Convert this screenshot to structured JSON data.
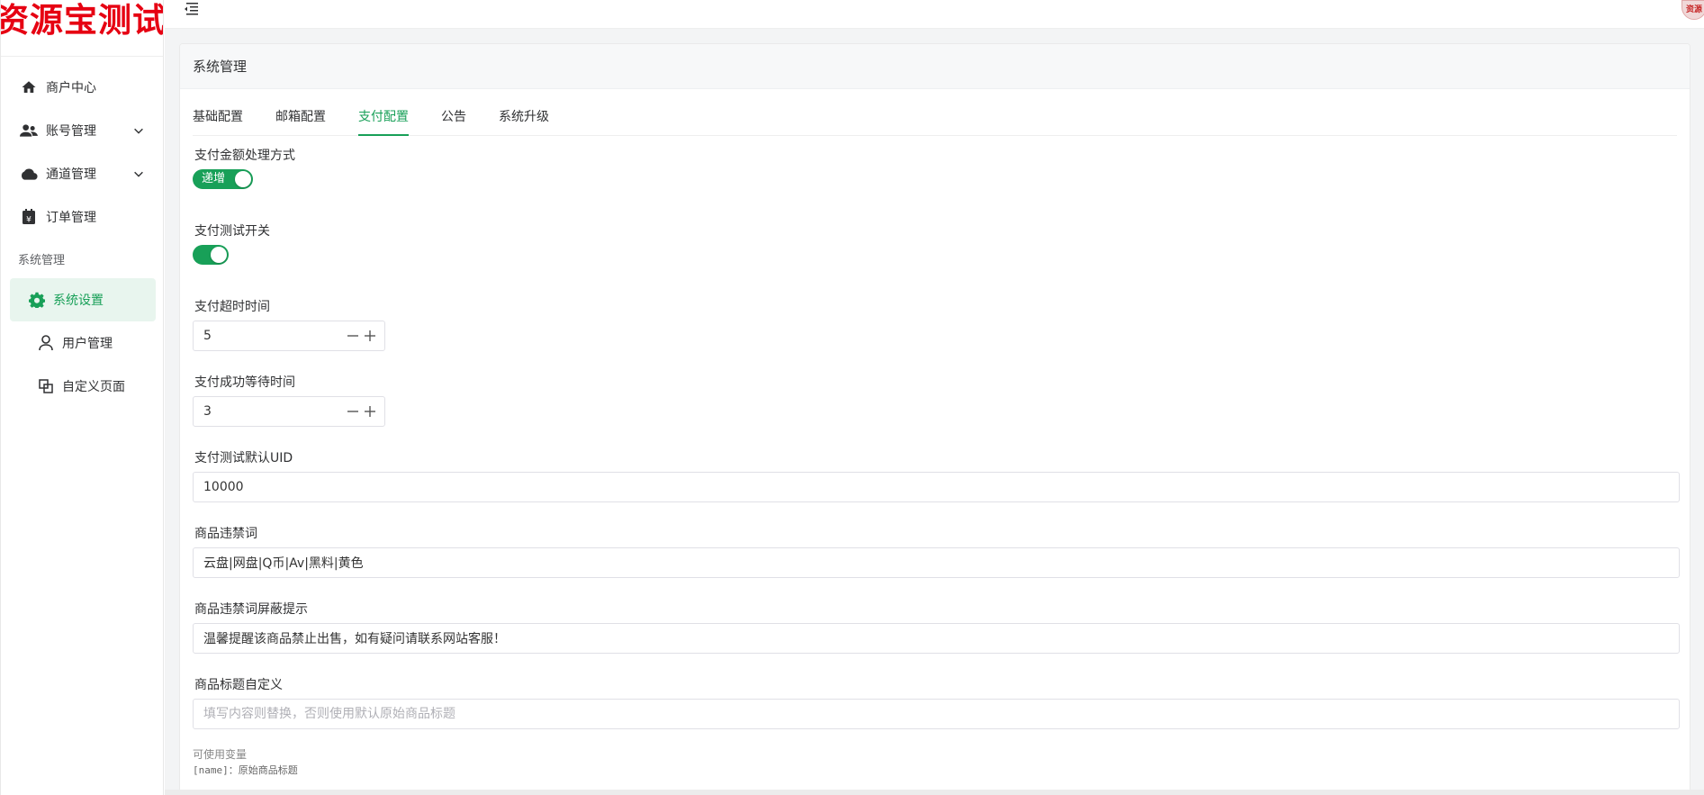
{
  "logo": {
    "text": "资源宝测试"
  },
  "sidebar": {
    "items": [
      {
        "label": "商户中心",
        "icon": "home-icon"
      },
      {
        "label": "账号管理",
        "icon": "users-icon",
        "expandable": true
      },
      {
        "label": "通道管理",
        "icon": "cloud-icon",
        "expandable": true
      },
      {
        "label": "订单管理",
        "icon": "order-icon"
      }
    ],
    "group_title": "系统管理",
    "sub_items": [
      {
        "label": "系统设置",
        "icon": "gear-icon",
        "active": true
      },
      {
        "label": "用户管理",
        "icon": "user-icon"
      },
      {
        "label": "自定义页面",
        "icon": "pages-icon"
      }
    ]
  },
  "header": {
    "avatar_text": "资源宝"
  },
  "card": {
    "title": "系统管理"
  },
  "tabs": [
    {
      "label": "基础配置"
    },
    {
      "label": "邮箱配置"
    },
    {
      "label": "支付配置",
      "active": true
    },
    {
      "label": "公告"
    },
    {
      "label": "系统升级"
    }
  ],
  "form": {
    "amount_mode": {
      "label": "支付金额处理方式",
      "switch_text": "递增",
      "on": true
    },
    "test_switch": {
      "label": "支付测试开关",
      "on": true
    },
    "timeout": {
      "label": "支付超时时间",
      "value": "5"
    },
    "success_wait": {
      "label": "支付成功等待时间",
      "value": "3"
    },
    "test_uid": {
      "label": "支付测试默认UID",
      "value": "10000"
    },
    "banned_words": {
      "label": "商品违禁词",
      "value": "云盘|网盘|Q币|Av|黑料|黄色"
    },
    "banned_tip": {
      "label": "商品违禁词屏蔽提示",
      "value": "温馨提醒该商品禁止出售，如有疑问请联系网站客服！"
    },
    "title_custom": {
      "label": "商品标题自定义",
      "placeholder": "填写内容则替换，否则使用默认原始商品标题"
    },
    "vars_hint": {
      "title": "可使用变量",
      "line1": "[name]：原始商品标题"
    }
  },
  "colors": {
    "accent": "#18a058",
    "logo_red": "#e60012"
  }
}
